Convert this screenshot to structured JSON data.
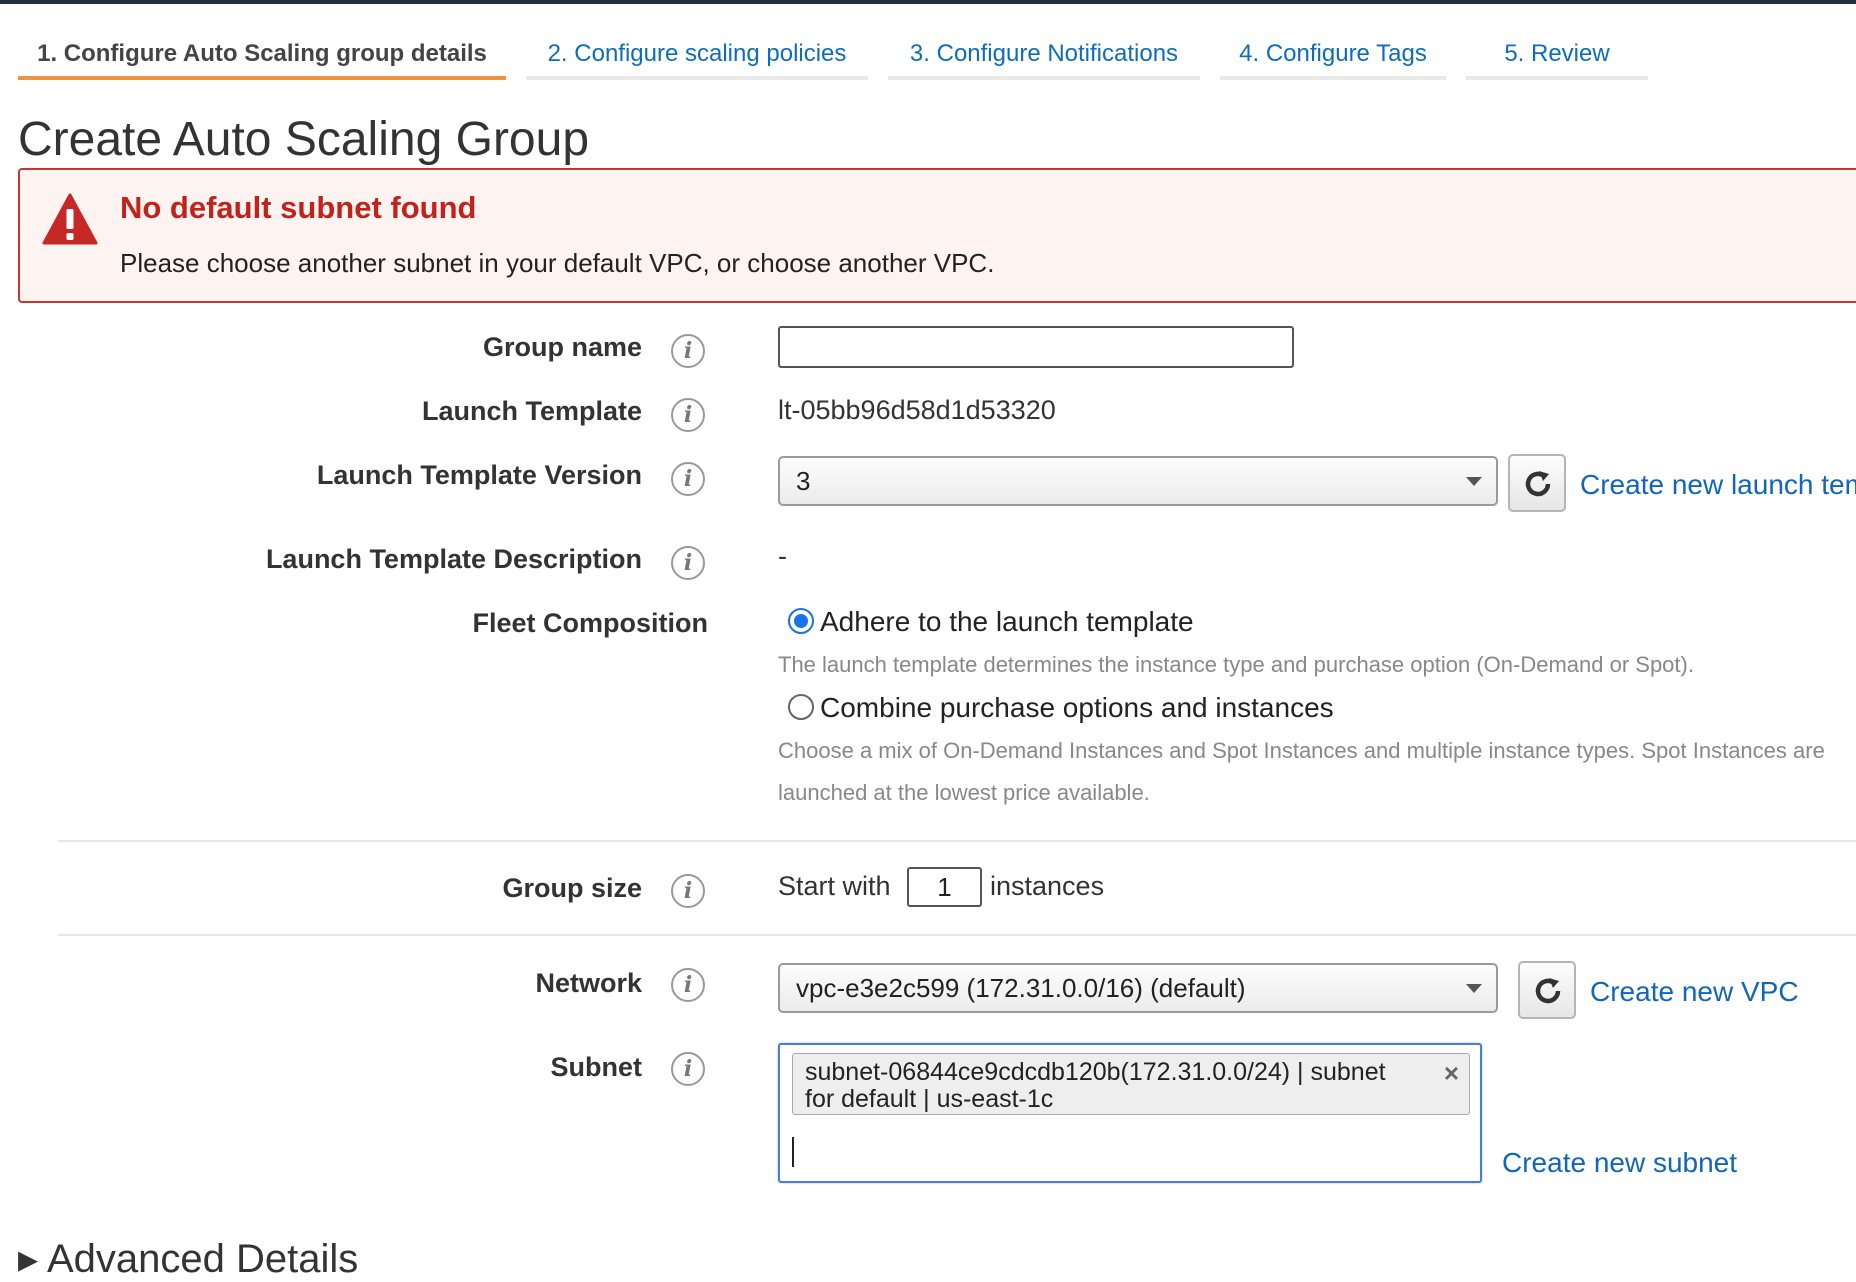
{
  "tabs": [
    {
      "label": "1. Configure Auto Scaling group details",
      "active": true
    },
    {
      "label": "2. Configure scaling policies",
      "active": false
    },
    {
      "label": "3. Configure Notifications",
      "active": false
    },
    {
      "label": "4. Configure Tags",
      "active": false
    },
    {
      "label": "5. Review",
      "active": false
    }
  ],
  "page_title": "Create Auto Scaling Group",
  "alert": {
    "icon": "warning-triangle-icon",
    "title": "No default subnet found",
    "message": "Please choose another subnet in your default VPC, or choose another VPC."
  },
  "form": {
    "group_name": {
      "label": "Group name",
      "value": ""
    },
    "launch_template": {
      "label": "Launch Template",
      "value": "lt-05bb96d58d1d53320"
    },
    "launch_template_version": {
      "label": "Launch Template Version",
      "value": "3",
      "create_link": "Create new launch template"
    },
    "launch_template_description": {
      "label": "Launch Template Description",
      "value": "-"
    },
    "fleet_composition": {
      "label": "Fleet Composition",
      "options": [
        {
          "label": "Adhere to the launch template",
          "checked": true,
          "help": "The launch template determines the instance type and purchase option (On-Demand or Spot)."
        },
        {
          "label": "Combine purchase options and instances",
          "checked": false,
          "help_line1": "Choose a mix of On-Demand Instances and Spot Instances and multiple instance types. Spot Instances are",
          "help_line2": "launched at the lowest price available."
        }
      ]
    },
    "group_size": {
      "label": "Group size",
      "prefix": "Start with",
      "value": "1",
      "suffix": "instances"
    },
    "network": {
      "label": "Network",
      "value": "vpc-e3e2c599 (172.31.0.0/16) (default)",
      "create_link": "Create new VPC"
    },
    "subnet": {
      "label": "Subnet",
      "selected_chip": "subnet-06844ce9cdcdb120b(172.31.0.0/24) | subnet for default | us-east-1c",
      "chip_close": "×",
      "create_link": "Create new subnet"
    }
  },
  "advanced_details": "Advanced Details",
  "icons": {
    "info": "info-icon",
    "refresh": "refresh-icon",
    "caret": "chevron-down-icon"
  },
  "colors": {
    "link": "#1166bb",
    "active_tab_underline": "#f0963a",
    "error": "#c0231b",
    "radio_selected": "#1a73e8"
  }
}
